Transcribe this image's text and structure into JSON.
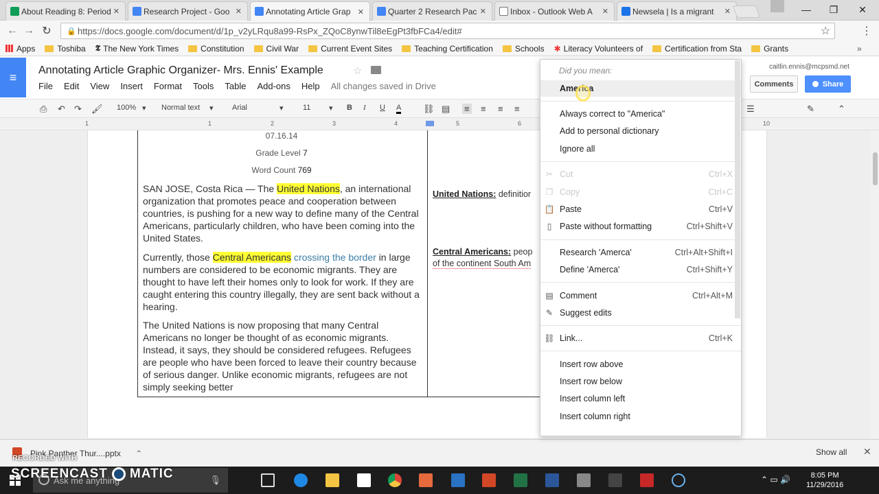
{
  "browser": {
    "tabs": [
      {
        "title": "About Reading 8: Period",
        "color": "#0f9d58"
      },
      {
        "title": "Research Project - Goo",
        "color": "#4285f4"
      },
      {
        "title": "Annotating Article Grap",
        "color": "#4285f4"
      },
      {
        "title": "Quarter 2 Research Pac",
        "color": "#4285f4"
      },
      {
        "title": "Inbox - Outlook Web A",
        "color": "#777777"
      },
      {
        "title": "Newsela | Is a migrant",
        "color": "#1a73e8"
      }
    ],
    "url": "https://docs.google.com/document/d/1p_v2yLRqu8a99-RsPx_ZQoC8ynwTil8eEgPt3fbFCa4/edit#",
    "bookmarks": [
      "Apps",
      "Toshiba",
      "The New York Times",
      "Constitution",
      "Civil War",
      "Current Event Sites",
      "Teaching Certification",
      "Schools",
      "Literacy Volunteers of",
      "Certification from Sta",
      "Grants"
    ]
  },
  "docs": {
    "title": "Annotating Article Graphic Organizer- Mrs. Ennis' Example",
    "menu": [
      "File",
      "Edit",
      "View",
      "Insert",
      "Format",
      "Tools",
      "Table",
      "Add-ons",
      "Help"
    ],
    "saved_status": "All changes saved in Drive",
    "account": "caitlin.ennis@mcpsmd.net",
    "comments_label": "Comments",
    "share_label": "Share",
    "toolbar": {
      "zoom": "100%",
      "style": "Normal text",
      "font": "Arial",
      "size": "11"
    },
    "ruler_numbers": [
      "1",
      "1",
      "2",
      "3",
      "4",
      "5",
      "6",
      "10"
    ]
  },
  "document": {
    "date": "07.16.14",
    "grade_label": "Grade Level",
    "grade_value": "7",
    "wordcount_label": "Word Count",
    "wordcount_value": "769",
    "p1_pre": "SAN JOSE, Costa Rica — The ",
    "p1_hl": "United Nations",
    "p1_post": ", an international organization that promotes peace and cooperation between countries, is pushing for a new way to define many of the Central Americans, particularly children, who have been coming into the United States.",
    "p2_pre": "Currently, those ",
    "p2_hl": "Central Americans",
    "p2_link": "crossing the border",
    "p2_post": " in large numbers are considered to be economic migrants. They are thought to have left their homes only to look for work. If they are caught entering this country illegally, they are sent back without a hearing.",
    "p3": "The United Nations is now proposing that many Central Americans no longer be thought of as economic migrants. Instead, it says, they should be considered refugees. Refugees are people who have been forced to leave their country because of serious danger. Unlike economic migrants, refugees are not simply seeking better",
    "def1_term": "United Nations:",
    "def1_text": " definitior",
    "def2_term": "Central Americans:",
    "def2_text": " peop",
    "def2_line2": "of the continent South Am"
  },
  "context_menu": {
    "did_you_mean": "Did you mean:",
    "suggestion": "America",
    "items": [
      {
        "label": "Always correct to \"America\"",
        "shortcut": "",
        "icon": "",
        "disabled": false
      },
      {
        "label": "Add to personal dictionary",
        "shortcut": "",
        "icon": "",
        "disabled": false
      },
      {
        "label": "Ignore all",
        "shortcut": "",
        "icon": "",
        "disabled": false
      },
      {
        "label": "Cut",
        "shortcut": "Ctrl+X",
        "icon": "scissors-icon",
        "disabled": true
      },
      {
        "label": "Copy",
        "shortcut": "Ctrl+C",
        "icon": "copy-icon",
        "disabled": true
      },
      {
        "label": "Paste",
        "shortcut": "Ctrl+V",
        "icon": "paste-icon",
        "disabled": false
      },
      {
        "label": "Paste without formatting",
        "shortcut": "Ctrl+Shift+V",
        "icon": "paste-plain-icon",
        "disabled": false
      },
      {
        "label": "Research 'Amerca'",
        "shortcut": "Ctrl+Alt+Shift+I",
        "icon": "",
        "disabled": false
      },
      {
        "label": "Define 'Amerca'",
        "shortcut": "Ctrl+Shift+Y",
        "icon": "",
        "disabled": false
      },
      {
        "label": "Comment",
        "shortcut": "Ctrl+Alt+M",
        "icon": "comment-icon",
        "disabled": false
      },
      {
        "label": "Suggest edits",
        "shortcut": "",
        "icon": "suggest-icon",
        "disabled": false
      },
      {
        "label": "Link...",
        "shortcut": "Ctrl+K",
        "icon": "link-icon",
        "disabled": false
      },
      {
        "label": "Insert row above",
        "shortcut": "",
        "icon": "",
        "disabled": false
      },
      {
        "label": "Insert row below",
        "shortcut": "",
        "icon": "",
        "disabled": false
      },
      {
        "label": "Insert column left",
        "shortcut": "",
        "icon": "",
        "disabled": false
      },
      {
        "label": "Insert column right",
        "shortcut": "",
        "icon": "",
        "disabled": false
      }
    ]
  },
  "downloads": {
    "file": "Pink Panther Thur....pptx",
    "show_all": "Show all"
  },
  "watermark": {
    "line1": "RECORDED WITH",
    "line2a": "SCREENCAST",
    "line2b": "MATIC"
  },
  "taskbar": {
    "search_placeholder": "Ask me anything",
    "time": "8:05 PM",
    "date": "11/29/2016"
  }
}
